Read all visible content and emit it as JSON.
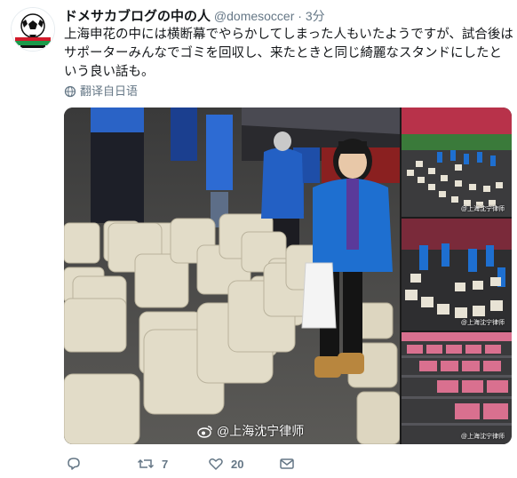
{
  "tweet": {
    "display_name": "ドメサカブログの中の人",
    "handle": "@domesoccer",
    "separator": "·",
    "timestamp": "3分",
    "text": "上海申花の中には横断幕でやらかしてしまった人もいたようですが、試合後はサポーターみんなでゴミを回収し、来たときと同じ綺麗なスタンドにしたという良い話も。",
    "translate_label": "翻译自日语"
  },
  "media": {
    "main_watermark": "@上海沈宁律师",
    "thumb_watermark": "@上海沈宁律师"
  },
  "actions": {
    "retweet_count": "7",
    "like_count": "20"
  },
  "colors": {
    "text_primary": "#14171a",
    "text_secondary": "#657786",
    "seat_beige": "#e2dcc8",
    "seat_pink": "#d9708f",
    "jacket_blue": "#1e6fd0"
  }
}
